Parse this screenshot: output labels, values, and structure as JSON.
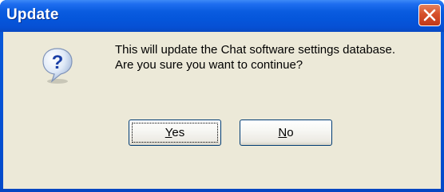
{
  "window": {
    "title": "Update",
    "accent_color": "#0a5ce0"
  },
  "dialog": {
    "icon": "question-icon",
    "message_line1": "This will update the Chat software settings database.",
    "message_line2": "Are you sure you want to continue?"
  },
  "buttons": {
    "yes_mnemonic": "Y",
    "yes_rest": "es",
    "no_mnemonic": "N",
    "no_rest": "o"
  }
}
